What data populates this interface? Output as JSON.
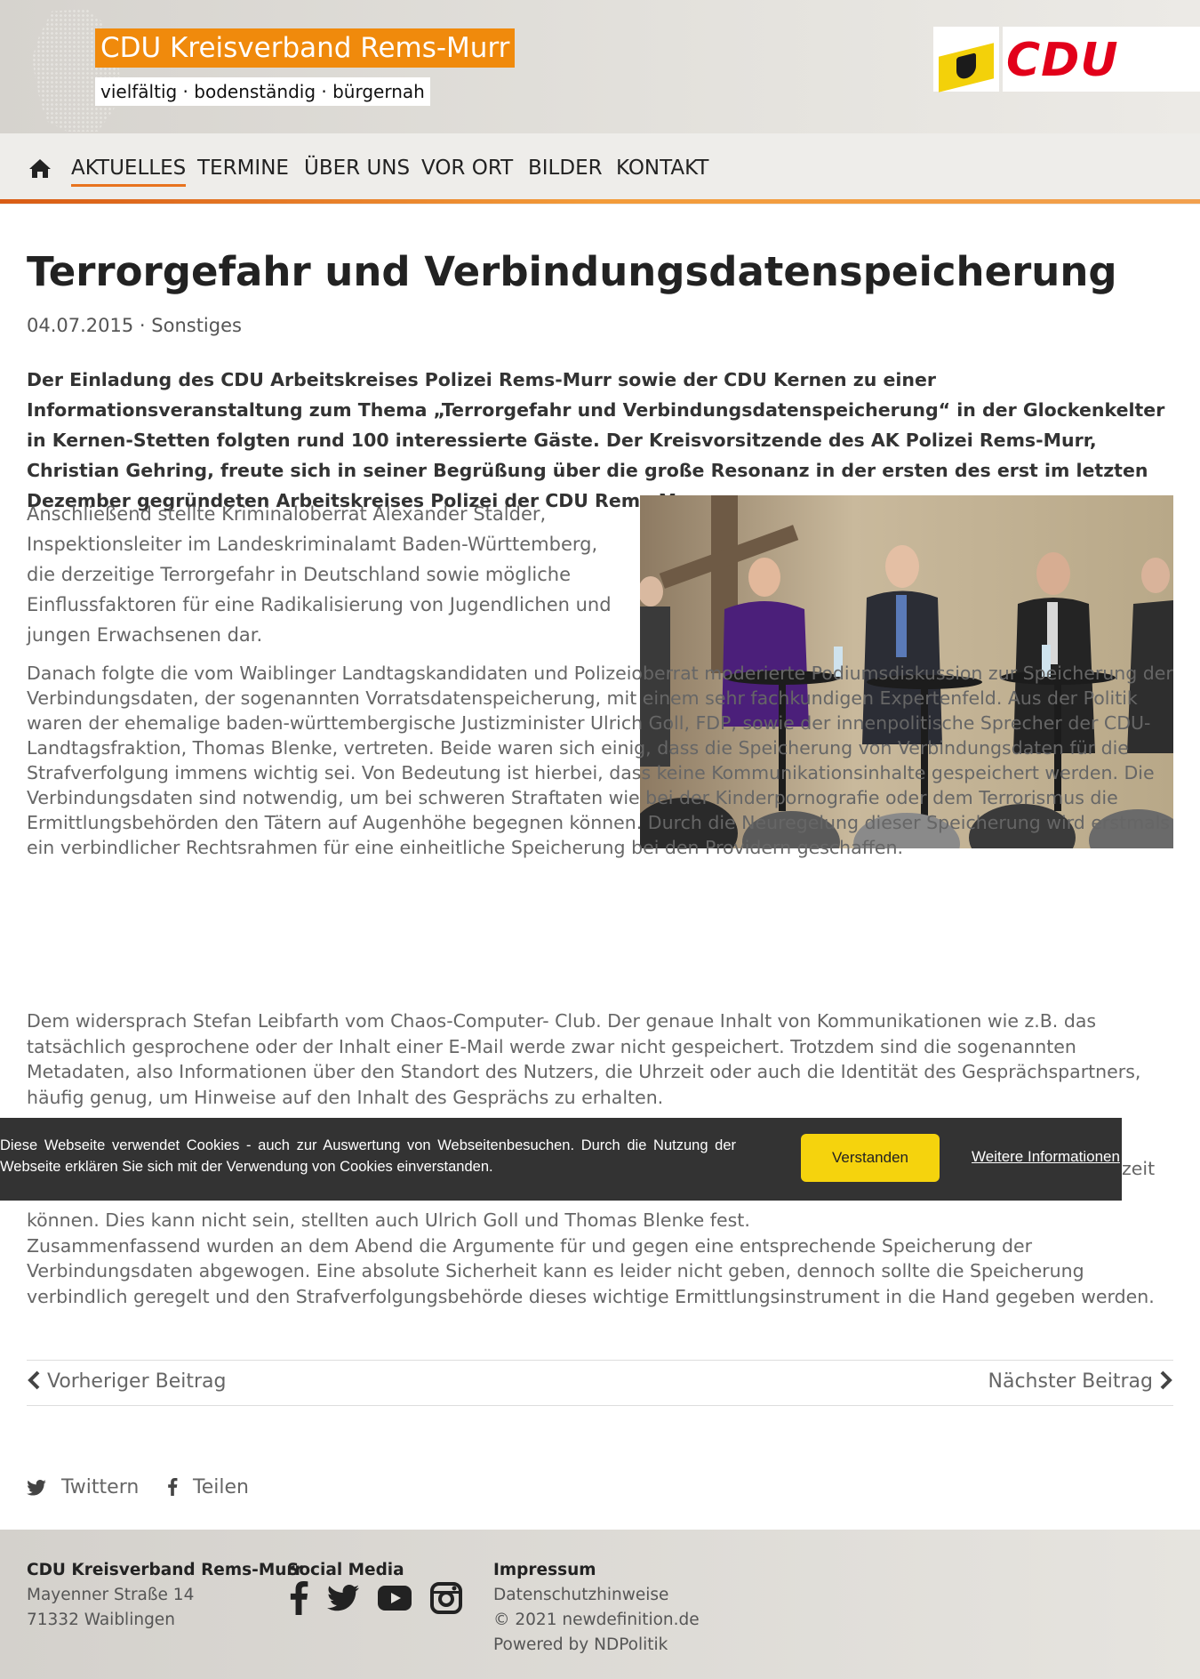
{
  "header": {
    "title": "CDU Kreisverband Rems-Murr",
    "tagline": "vielfältig · bodenständig · bürgernah",
    "logo_text": "CDU",
    "colors": {
      "orange": "#f08a0c",
      "cdu_red": "#e2001a",
      "flag_yellow": "#f3d10a"
    }
  },
  "nav": {
    "home_icon": "home-icon",
    "items": [
      "AKTUELLES",
      "TERMINE",
      "ÜBER UNS",
      "VOR ORT",
      "BILDER",
      "KONTAKT"
    ],
    "active": "AKTUELLES"
  },
  "article": {
    "title": "Terrorgefahr und Verbindungsdatenspeicherung",
    "meta": "04.07.2015 · Sonstiges",
    "lead": "Der Einladung des CDU Arbeitskreises Polizei Rems-Murr sowie der CDU Kernen zu einer Informationsveranstaltung zum Thema „Terrorgefahr und Verbindungsdatenspeicherung“ in der Glockenkelter in Kernen-Stetten folgten rund 100 interessierte Gäste. Der Kreisvorsitzende des AK Polizei Rems-Murr, Christian Gehring, freute sich in seiner Begrüßung über die große Resonanz in der ersten des erst im letzten Dezember gegründeten Arbeitskreises Polizei der CDU Rems-Murr.",
    "p1": "Anschließend stellte Kriminaloberrat Alexander Stalder, Inspektionsleiter im Landeskriminalamt Baden-Württemberg, die derzeitige Terrorgefahr in Deutschland sowie mögliche Einflussfaktoren für eine Radikalisierung von Jugendlichen und jungen Erwachsenen dar.",
    "p2": "Danach folgte die vom Waiblinger Landtagskandidaten und Polizeioberrat moderierte Podiumsdiskussion zur Speicherung der Verbindungsdaten, der sogenannten Vorratsdatenspeicherung, mit einem sehr fachkundigen Expertenfeld. Aus der Politik waren der ehemalige baden-württembergische Justizminister Ulrich Goll, FDP, sowie der innenpolitische Sprecher der CDU-Landtagsfraktion, Thomas Blenke, vertreten. Beide waren sich einig, dass die Speicherung von Verbindungsdaten für die Strafverfolgung immens wichtig sei. Von Bedeutung ist hierbei, dass keine Kommunikationsinhalte gespeichert werden. Die Verbindungsdaten sind notwendig, um bei schweren Straftaten wie bei der Kinderpornografie oder dem Terrorismus die Ermittlungsbehörden den Tätern auf Augenhöhe begegnen können. Durch die Neuregelung dieser Speicherung wird erstmals ein verbindlicher Rechtsrahmen für eine einheitliche Speicherung bei den Providern geschaffen.",
    "p3": "Dem widersprach Stefan Leibfarth vom Chaos-Computer- Club. Der genaue Inhalt von Kommunikationen wie z.B. das tatsächlich gesprochene oder der Inhalt einer E-Mail werde zwar nicht gespeichert. Trotzdem sind die sogenannten Metadaten, also Informationen über den Standort des Nutzers, die Uhrzeit oder auch die Identität des Gesprächspartners, häufig genug, um Hinweise auf den Inhalt des Gesprächs zu erhalten.",
    "p4_partial": "zeit",
    "p5": "können. Dies kann nicht sein, stellten auch Ulrich Goll und Thomas Blenke fest.\nZusammenfassend wurden an dem Abend die Argumente für und gegen eine entsprechende Speicherung der Verbindungsdaten abgewogen. Eine absolute Sicherheit kann es leider nicht geben, dennoch sollte die Speicherung verbindlich geregelt und den Strafverfolgungsbehörde dieses wichtige Ermittlungsinstrument in die Hand gegeben werden."
  },
  "cookie": {
    "text": "Diese Webseite verwendet Cookies - auch zur Auswertung von Webseitenbesuchen. Durch die Nutzung der Webseite erklären Sie sich mit der Verwendung von Cookies einverstanden.",
    "accept": "Verstanden",
    "more": "Weitere Informationen"
  },
  "post_nav": {
    "prev": "Vorheriger Beitrag",
    "next": "Nächster Beitrag"
  },
  "share": {
    "twitter": "Twittern",
    "facebook": "Teilen"
  },
  "footer": {
    "org": "CDU Kreisverband Rems-Murr",
    "street": "Mayenner Straße 14",
    "city": "71332 Waiblingen",
    "social_heading": "Social Media",
    "social_icons": [
      "facebook-icon",
      "twitter-icon",
      "youtube-icon",
      "instagram-icon"
    ],
    "impressum": "Impressum",
    "datenschutz": "Datenschutzhinweise",
    "copyright": "© 2021 newdefinition.de",
    "powered": "Powered by NDPolitik"
  }
}
